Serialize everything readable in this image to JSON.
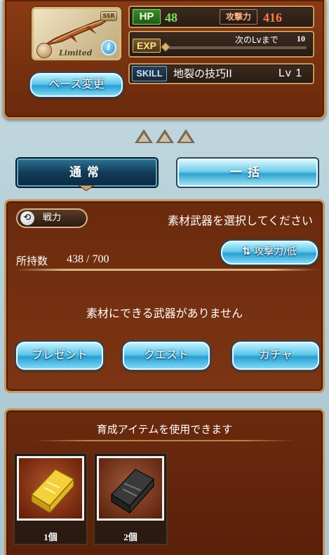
{
  "weapon": {
    "rarity_badge": "SSR",
    "limited_label": "Limited",
    "info_icon_glyph": "i",
    "base_change_label": "ベース変更"
  },
  "stats": {
    "hp_label": "HP",
    "hp_value": "48",
    "atk_label": "攻撃力",
    "atk_value": "416",
    "exp_label": "EXP",
    "next_lv_text": "次のLvまで",
    "next_lv_value": "10",
    "exp_progress": 0.0,
    "skill_label": "SKILL",
    "skill_name": "地裂の技巧II",
    "skill_level": "Lv 1"
  },
  "rarity_triangles": 3,
  "tabs": {
    "normal": "通常",
    "bulk": "一括"
  },
  "material": {
    "power_label": "戦力",
    "select_message": "素材武器を選択してください",
    "owned_label": "所持数",
    "owned_count": "438 / 700",
    "sort_label": "攻撃力/低",
    "sort_icon": "⇅",
    "empty_message": "素材にできる武器がありません",
    "present_button": "プレゼント",
    "quest_button": "クエスト",
    "gacha_button": "ガチャ"
  },
  "growth": {
    "title": "育成アイテムを使用できます",
    "items": [
      {
        "name": "gold-ingot",
        "count": "1個"
      },
      {
        "name": "dark-ingot",
        "count": "2個"
      }
    ]
  },
  "colors": {
    "panel_brown": "#7a3210",
    "gold_border": "#c9935a",
    "hp_green": "#7fe05a",
    "atk_red": "#ff7a4a",
    "button_blue": "#5fc6ea"
  }
}
